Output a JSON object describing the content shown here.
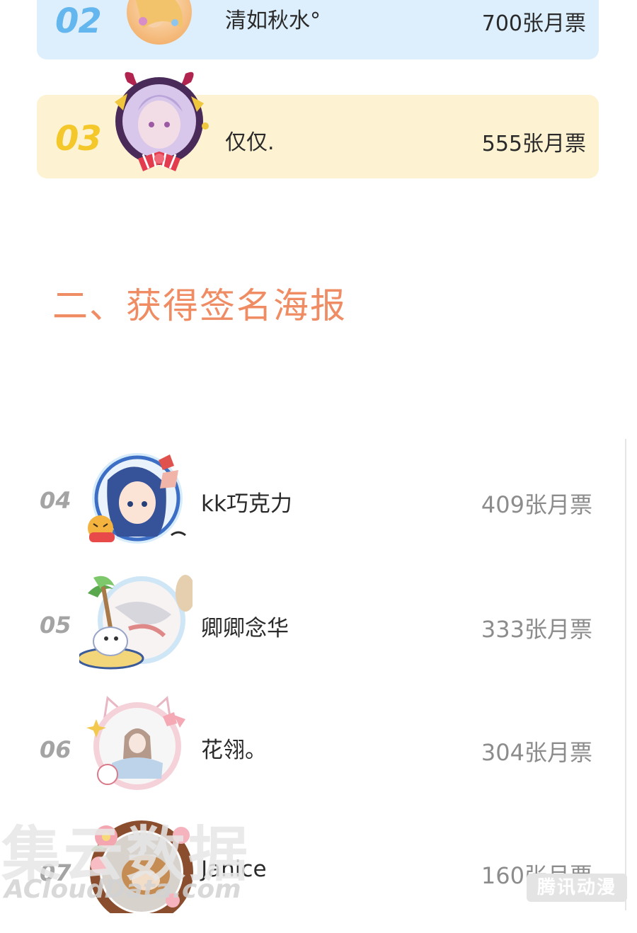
{
  "top_ranks": [
    {
      "rank": "02",
      "name": "清如秋水°",
      "votes": "700张月票"
    },
    {
      "rank": "03",
      "name": "仅仅.",
      "votes": "555张月票"
    }
  ],
  "section_title": "二、获得签名海报",
  "list": [
    {
      "rank": "04",
      "name": "kk巧克力",
      "votes": "409张月票",
      "avatar_icon": "anime-girl-avatar-icon"
    },
    {
      "rank": "05",
      "name": "卿卿念华",
      "votes": "333张月票",
      "avatar_icon": "palm-tree-frame-avatar-icon"
    },
    {
      "rank": "06",
      "name": "花翎。",
      "votes": "304张月票",
      "avatar_icon": "cat-ear-frame-avatar-icon"
    },
    {
      "rank": "07",
      "name": "Janice",
      "votes": "160张月票",
      "avatar_icon": "flower-wreath-avatar-icon"
    }
  ],
  "watermark": {
    "text": "集云数据",
    "url": "ACloudData.com"
  },
  "corner_logo": "腾讯动漫",
  "colors": {
    "blue_card": "#ddeefc",
    "yellow_card": "#fdf3d2",
    "rank_blue": "#63b6ee",
    "rank_yellow": "#f4c82a",
    "section_title": "#ef8c63"
  }
}
